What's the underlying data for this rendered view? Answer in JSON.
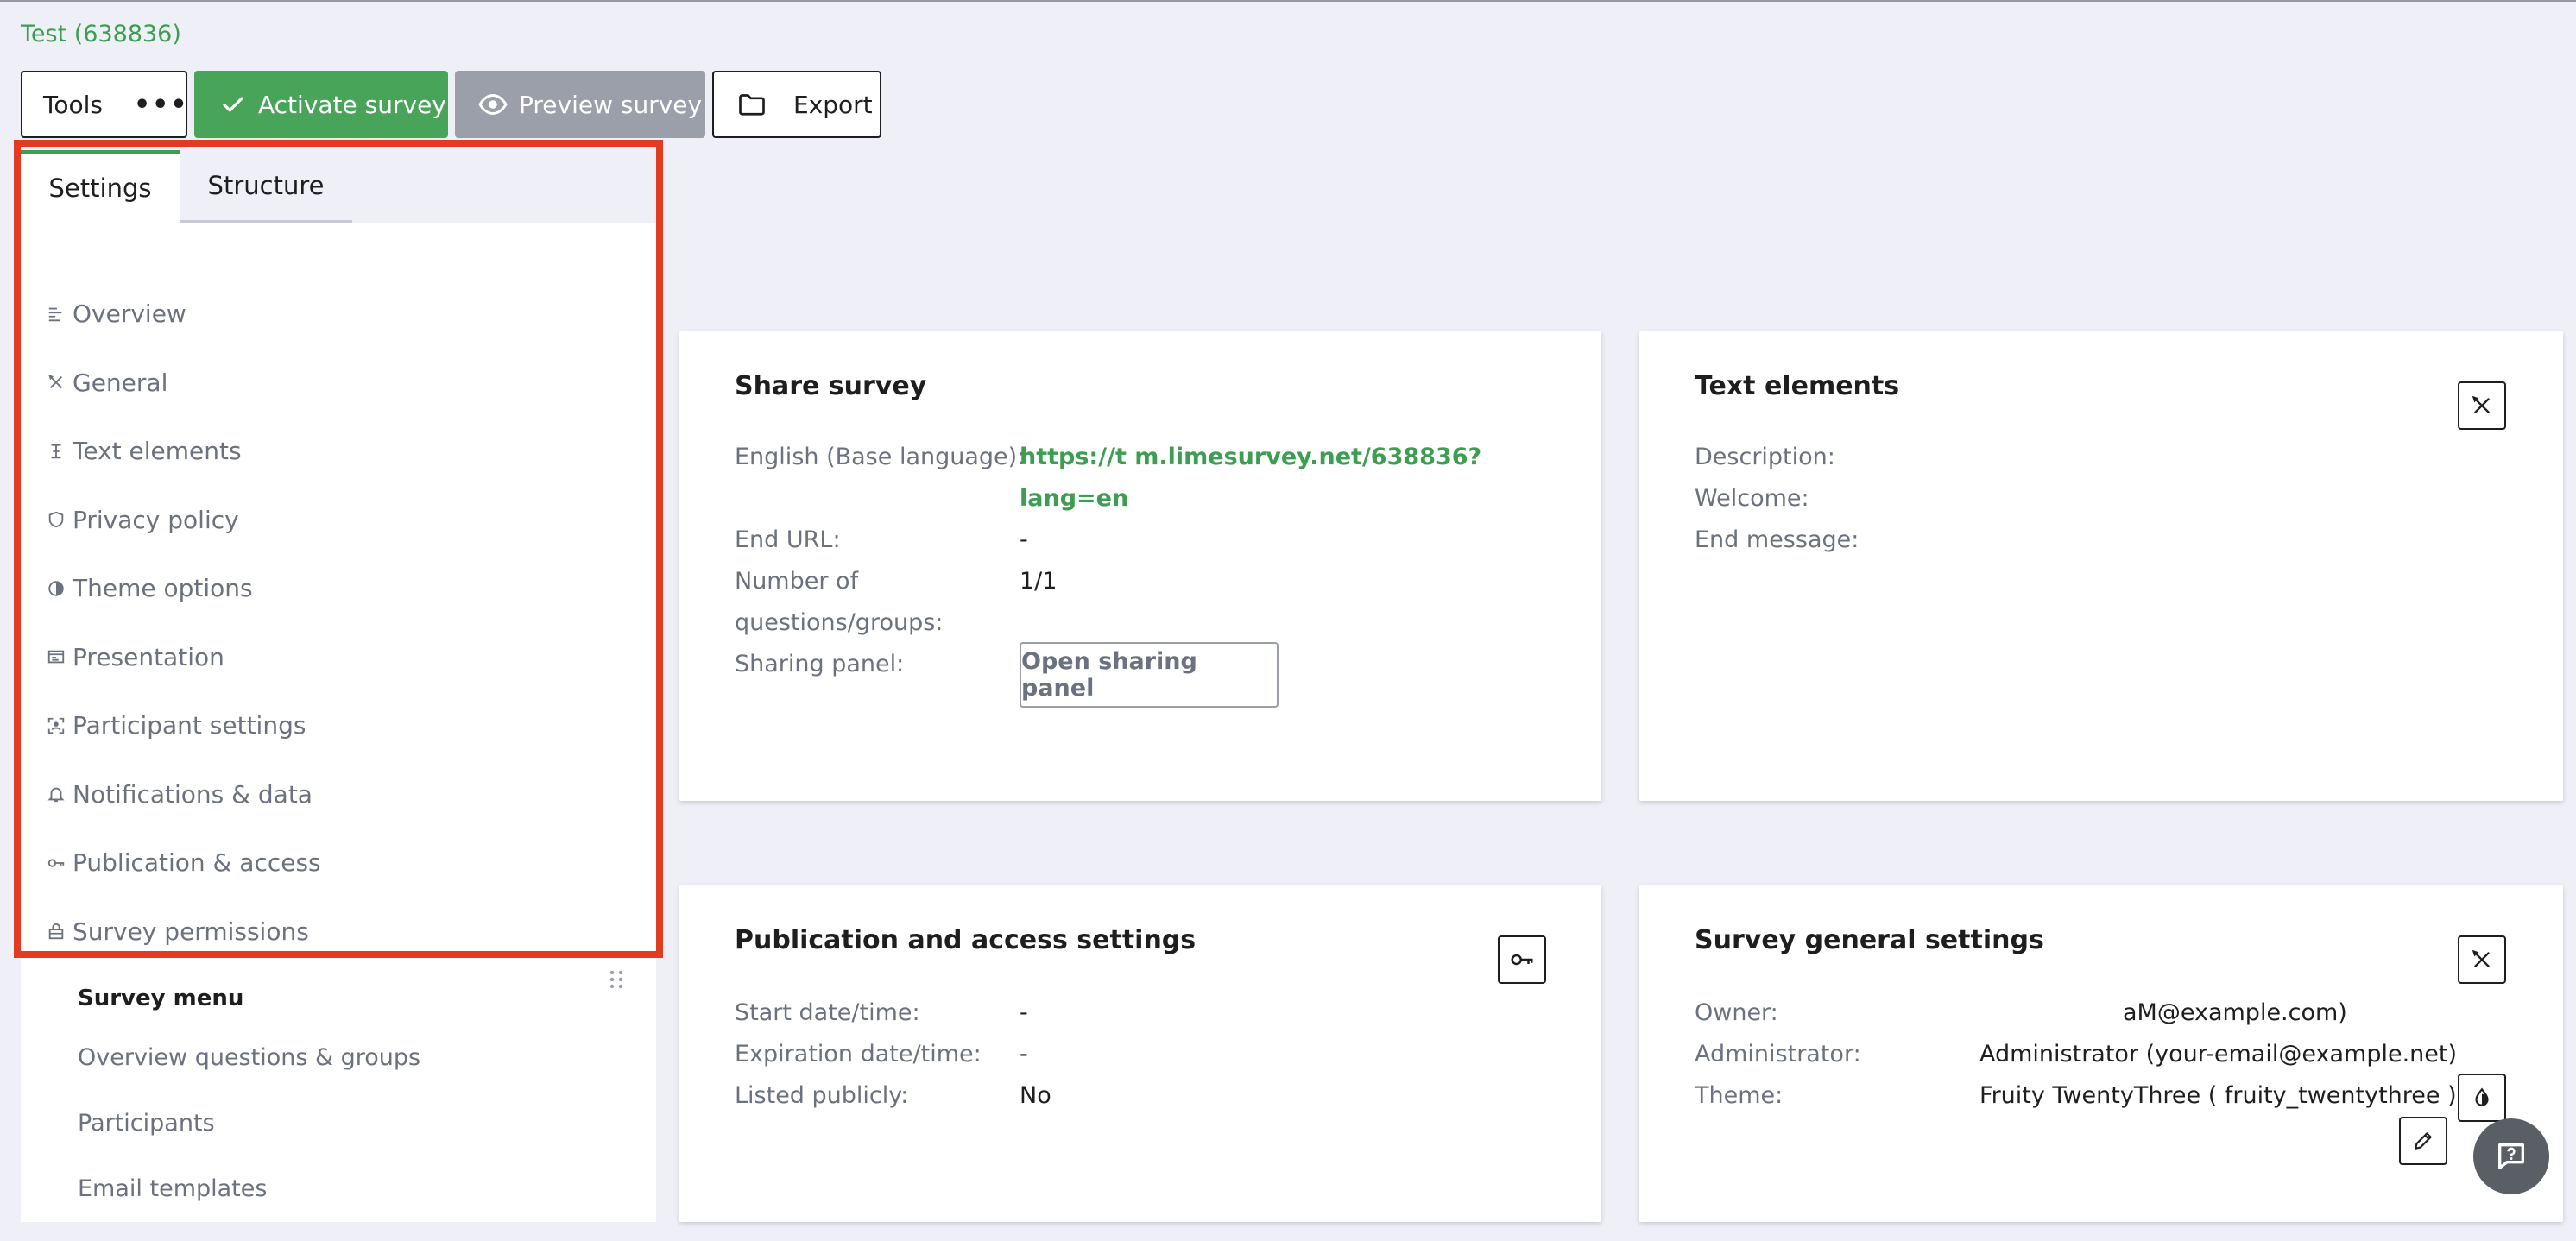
{
  "survey": {
    "title": "Test (638836)"
  },
  "toolbar": {
    "tools_label": "Tools",
    "more_label": "•••",
    "activate_label": "Activate survey",
    "preview_label": "Preview survey",
    "export_label": "Export"
  },
  "sidepanel": {
    "tabs": [
      {
        "label": "Settings",
        "active": true
      },
      {
        "label": "Structure",
        "active": false
      }
    ],
    "settings_menu": [
      {
        "label": "Overview",
        "icon": "overview-icon"
      },
      {
        "label": "General",
        "icon": "tools-icon"
      },
      {
        "label": "Text elements",
        "icon": "text-cursor-icon"
      },
      {
        "label": "Privacy policy",
        "icon": "shield-icon"
      },
      {
        "label": "Theme options",
        "icon": "contrast-icon"
      },
      {
        "label": "Presentation",
        "icon": "presentation-icon"
      },
      {
        "label": "Participant settings",
        "icon": "participant-icon"
      },
      {
        "label": "Notifications & data",
        "icon": "bell-icon"
      },
      {
        "label": "Publication & access",
        "icon": "key-icon"
      },
      {
        "label": "Survey permissions",
        "icon": "lock-icon"
      }
    ],
    "survey_menu": {
      "title": "Survey menu",
      "items": [
        "Overview questions & groups",
        "Participants",
        "Email templates"
      ]
    }
  },
  "cards": {
    "share": {
      "title": "Share survey",
      "base_language_label": "English (Base language):",
      "url_line1": "https://t        m.limesurvey.net/638836?",
      "url_line2": "lang=en",
      "end_url_label": "End URL:",
      "end_url_value": "-",
      "num_label_1": "Number of",
      "num_label_2": "questions/groups:",
      "num_value": "1/1",
      "sharing_label": "Sharing panel:",
      "sharing_button": "Open sharing panel"
    },
    "text_elements": {
      "title": "Text elements",
      "description_label": "Description:",
      "welcome_label": "Welcome:",
      "end_message_label": "End message:"
    },
    "publication": {
      "title": "Publication and access settings",
      "start_label": "Start date/time:",
      "start_value": "-",
      "expiration_label": "Expiration date/time:",
      "expiration_value": "-",
      "listed_label": "Listed publicly:",
      "listed_value": "No"
    },
    "general": {
      "title": "Survey general settings",
      "owner_label": "Owner:",
      "owner_value": "aM@example.com)",
      "admin_label": "Administrator:",
      "admin_value": "Administrator (your-email@example.net)",
      "theme_label": "Theme:",
      "theme_value": "Fruity TwentyThree ( fruity_twentythree )"
    }
  },
  "colors": {
    "accent_green": "#48a459",
    "highlight_red": "#e23b22",
    "page_bg": "#eeeff7"
  }
}
